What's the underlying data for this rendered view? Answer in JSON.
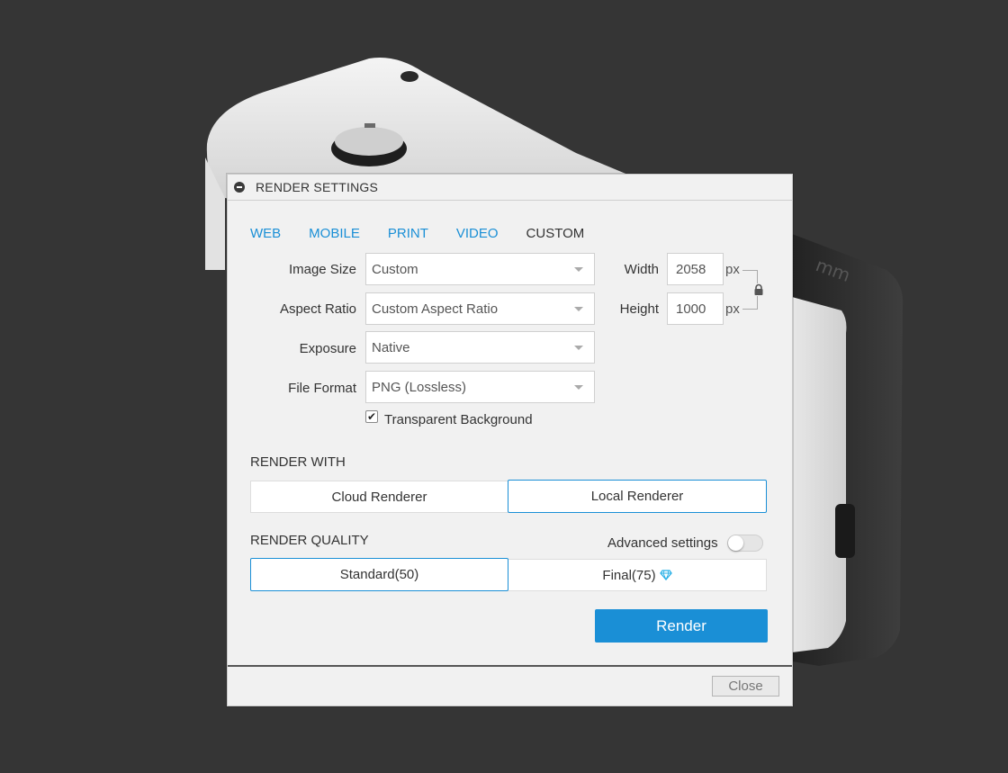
{
  "dialog": {
    "title": "RENDER SETTINGS"
  },
  "tabs": [
    {
      "label": "WEB",
      "active": false
    },
    {
      "label": "MOBILE",
      "active": false
    },
    {
      "label": "PRINT",
      "active": false
    },
    {
      "label": "VIDEO",
      "active": false
    },
    {
      "label": "CUSTOM",
      "active": true
    }
  ],
  "settings": {
    "image_size": {
      "label": "Image Size",
      "value": "Custom"
    },
    "aspect_ratio": {
      "label": "Aspect Ratio",
      "value": "Custom Aspect Ratio"
    },
    "exposure": {
      "label": "Exposure",
      "value": "Native"
    },
    "file_format": {
      "label": "File Format",
      "value": "PNG (Lossless)"
    },
    "transparent_background": {
      "label": "Transparent Background",
      "checked": true,
      "check_glyph": "✔"
    }
  },
  "dimensions": {
    "width": {
      "label": "Width",
      "value": "2058",
      "unit": "px"
    },
    "height": {
      "label": "Height",
      "value": "1000",
      "unit": "px"
    },
    "lock_icon": "lock-icon"
  },
  "render_with": {
    "title": "RENDER WITH",
    "options": [
      "Cloud Renderer",
      "Local Renderer"
    ],
    "selected": "Local Renderer"
  },
  "render_quality": {
    "title": "RENDER QUALITY",
    "advanced_label": "Advanced settings",
    "advanced_enabled": false,
    "options": [
      "Standard(50)",
      "Final(75)"
    ],
    "selected": "Standard(50)",
    "final_icon": "diamond-icon"
  },
  "actions": {
    "render_label": "Render",
    "close_label": "Close"
  },
  "colors": {
    "accent": "#1a8fd6",
    "background": "#353535",
    "panel": "#f1f1f1"
  }
}
